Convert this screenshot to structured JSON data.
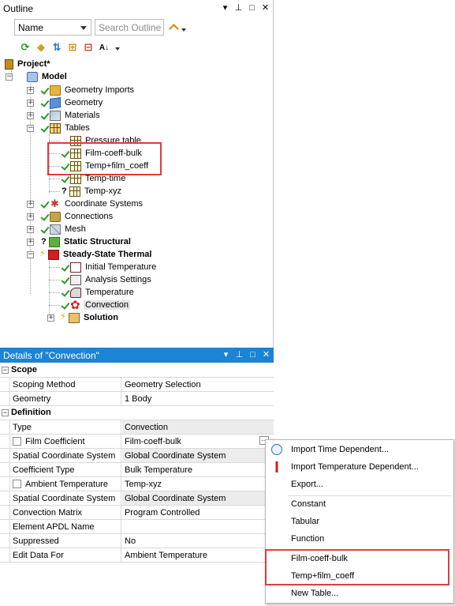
{
  "outline": {
    "title": "Outline",
    "title_buttons": [
      "▾",
      "⊥",
      "□",
      "✕"
    ],
    "name_select": "Name",
    "search_placeholder": "Search Outline",
    "tree": {
      "project": "Project*",
      "model": "Model",
      "geometry_imports": "Geometry Imports",
      "geometry": "Geometry",
      "materials": "Materials",
      "tables": "Tables",
      "pressure_table": "Pressure table",
      "film_coeff_bulk": "Film-coeff-bulk",
      "temp_film_coeff": "Temp+film_coeff",
      "temp_time": "Temp-time",
      "temp_xyz": "Temp-xyz",
      "coordinate_systems": "Coordinate Systems",
      "connections": "Connections",
      "mesh": "Mesh",
      "static_structural": "Static Structural",
      "steady_state_thermal": "Steady-State Thermal",
      "initial_temperature": "Initial Temperature",
      "analysis_settings": "Analysis Settings",
      "temperature": "Temperature",
      "convection": "Convection",
      "solution": "Solution"
    }
  },
  "details": {
    "title": "Details of \"Convection\"",
    "title_buttons": [
      "▾",
      "⊥",
      "□",
      "✕"
    ],
    "sections": {
      "scope": "Scope",
      "definition": "Definition"
    },
    "rows": {
      "scoping_method": {
        "key": "Scoping Method",
        "value": "Geometry Selection"
      },
      "geometry": {
        "key": "Geometry",
        "value": "1 Body"
      },
      "type": {
        "key": "Type",
        "value": "Convection"
      },
      "film_coefficient": {
        "key": "Film Coefficient",
        "value": "Film-coeff-bulk"
      },
      "spatial_coord_1": {
        "key": "Spatial Coordinate System",
        "value": "Global Coordinate System"
      },
      "coefficient_type": {
        "key": "Coefficient Type",
        "value": "Bulk Temperature"
      },
      "ambient_temperature": {
        "key": "Ambient Temperature",
        "value": "Temp-xyz"
      },
      "spatial_coord_2": {
        "key": "Spatial Coordinate System",
        "value": "Global Coordinate System"
      },
      "convection_matrix": {
        "key": "Convection Matrix",
        "value": "Program Controlled"
      },
      "element_apdl_name": {
        "key": "Element APDL Name",
        "value": ""
      },
      "suppressed": {
        "key": "Suppressed",
        "value": "No"
      },
      "edit_data_for": {
        "key": "Edit Data For",
        "value": "Ambient Temperature"
      }
    }
  },
  "context_menu": {
    "import_time": "Import Time Dependent...",
    "import_temp": "Import Temperature Dependent...",
    "export": "Export...",
    "constant": "Constant",
    "tabular": "Tabular",
    "function": "Function",
    "film_coeff_bulk": "Film-coeff-bulk",
    "temp_film_coeff": "Temp+film_coeff",
    "new_table": "New Table..."
  },
  "colors": {
    "details_title_bg": "#1a84d6",
    "highlight_red": "#e03c3c",
    "check_green": "#2a9a2a"
  }
}
